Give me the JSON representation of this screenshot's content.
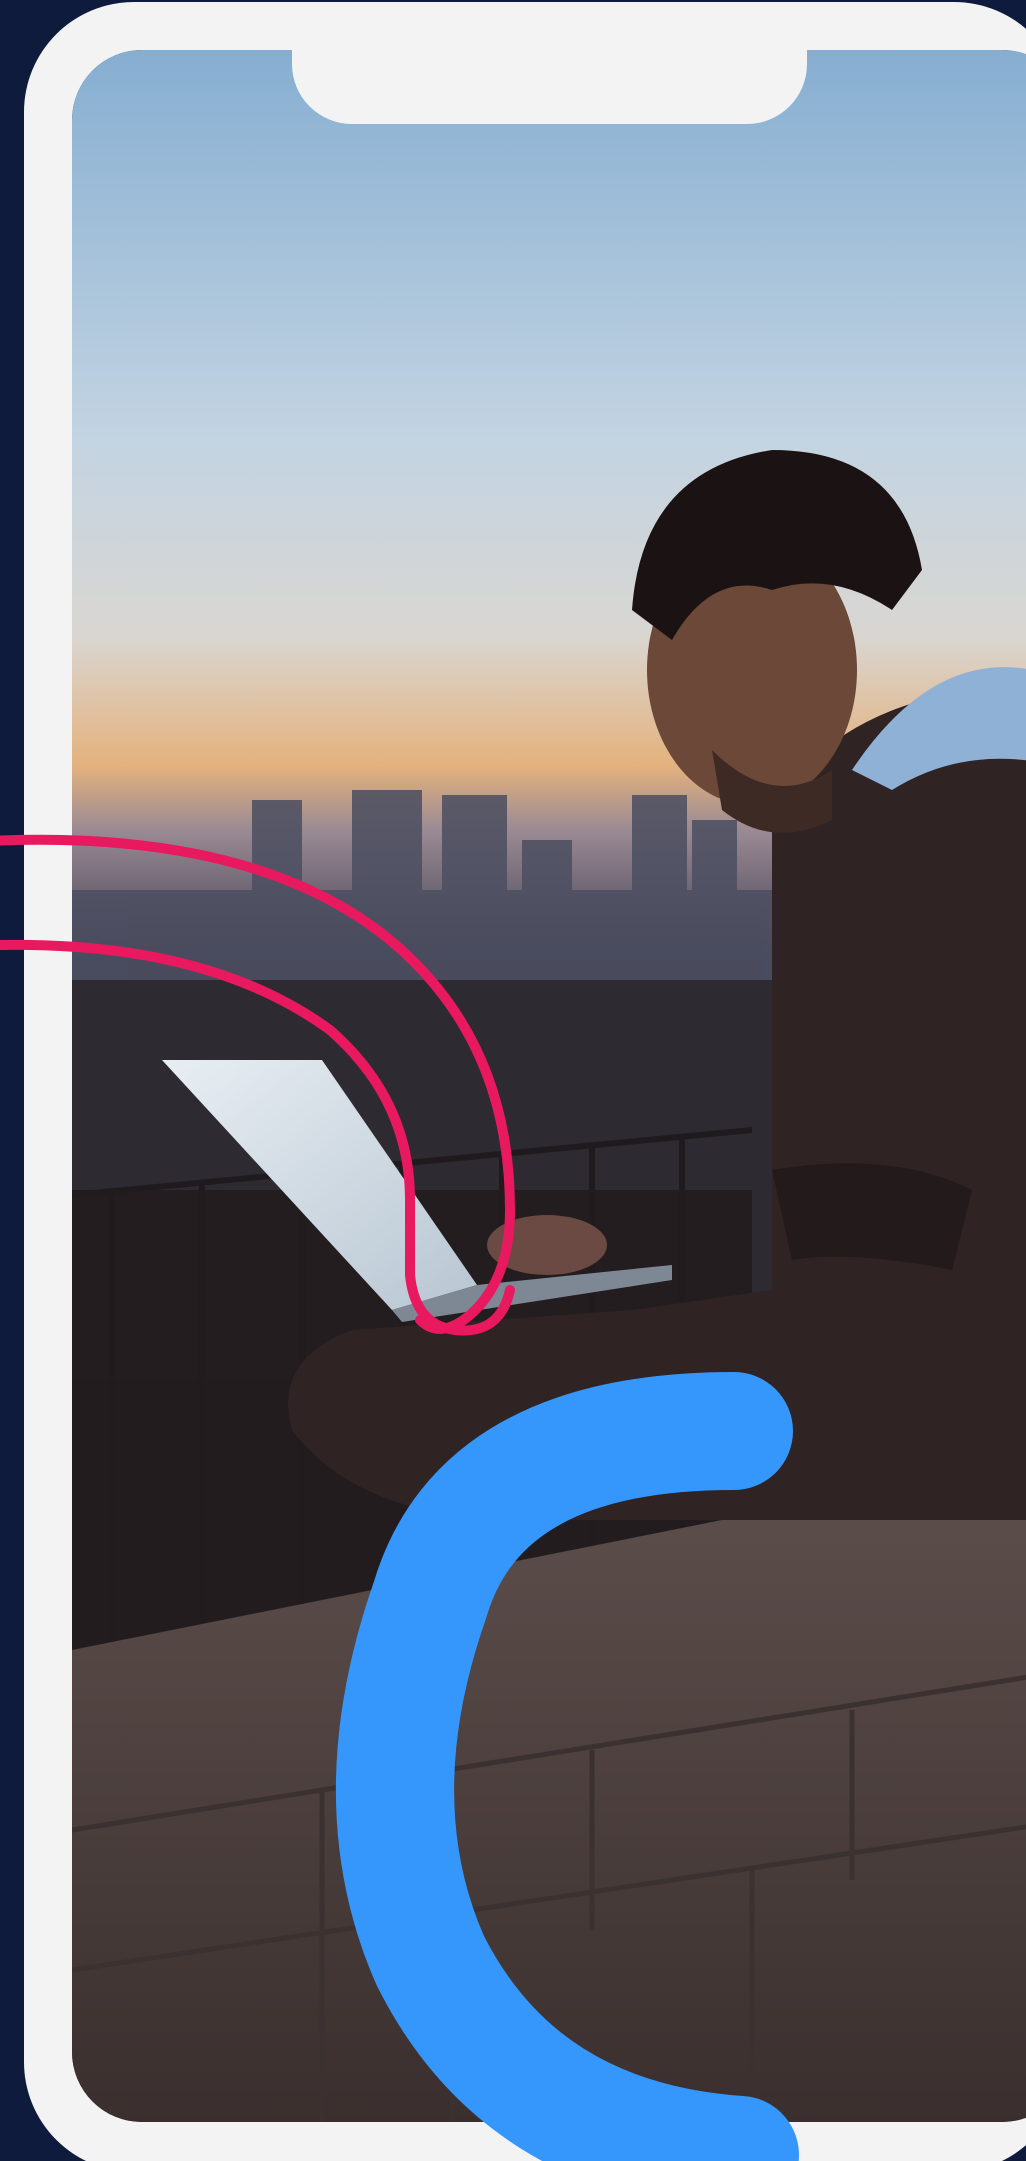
{
  "device": {
    "type": "phone-mockup",
    "frame_color": "#f3f3f3",
    "background_color": "#0f1b3d"
  },
  "photo": {
    "icon": "photo-icon",
    "colors": {
      "sky_top": "#8fb3d2",
      "sky_mid": "#c5d6e4",
      "sunset": "#e2ab78",
      "city_haze": "#4a4f63",
      "ground": "#241d1f",
      "wall": "#574a49",
      "laptop_screen": "#d9e2ea",
      "hoodie": "#3a2b2b",
      "hood_blue": "#8fb1d6"
    }
  },
  "decorations": {
    "pink_arcs_color": "#e8195f",
    "blue_arc_color": "#3597fc"
  }
}
